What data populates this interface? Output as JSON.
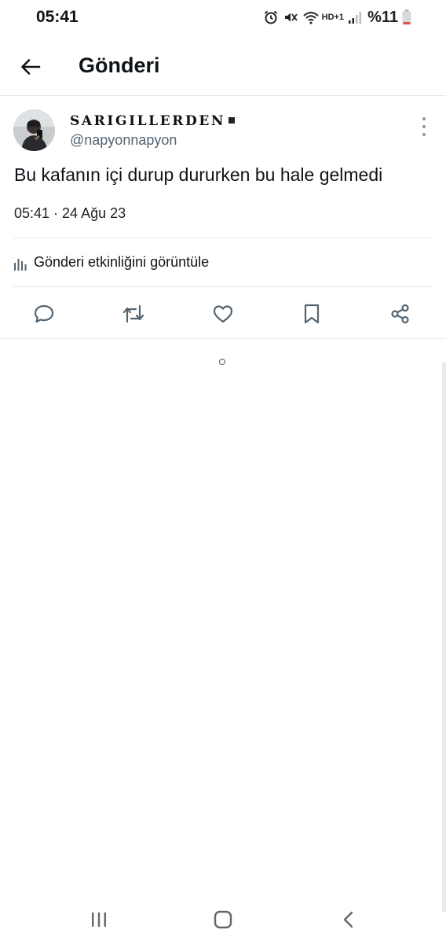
{
  "status_bar": {
    "time": "05:41",
    "network_label": "HD+1",
    "battery": "%11",
    "icons": [
      "alarm-icon",
      "mute-icon",
      "wifi-icon",
      "signal-icon",
      "battery-icon"
    ]
  },
  "header": {
    "title": "Gönderi",
    "back_icon": "arrow-left-icon"
  },
  "post": {
    "display_name": "SARIGILLERDEN",
    "handle": "@napyonnapyon",
    "text": "Bu kafanın içi durup dururken bu hale gelmedi",
    "timestamp": "05:41 · 24 Ağu 23",
    "activity_label": "Gönderi etkinliğini görüntüle",
    "actions": [
      "reply-icon",
      "retweet-icon",
      "like-icon",
      "bookmark-icon",
      "share-icon"
    ]
  },
  "nav_bar": {
    "buttons": [
      "recents-icon",
      "home-icon",
      "back-icon"
    ]
  },
  "colors": {
    "text_primary": "#0f1419",
    "text_secondary": "#536471",
    "divider": "#e5e7ea",
    "icon": "#536471"
  }
}
